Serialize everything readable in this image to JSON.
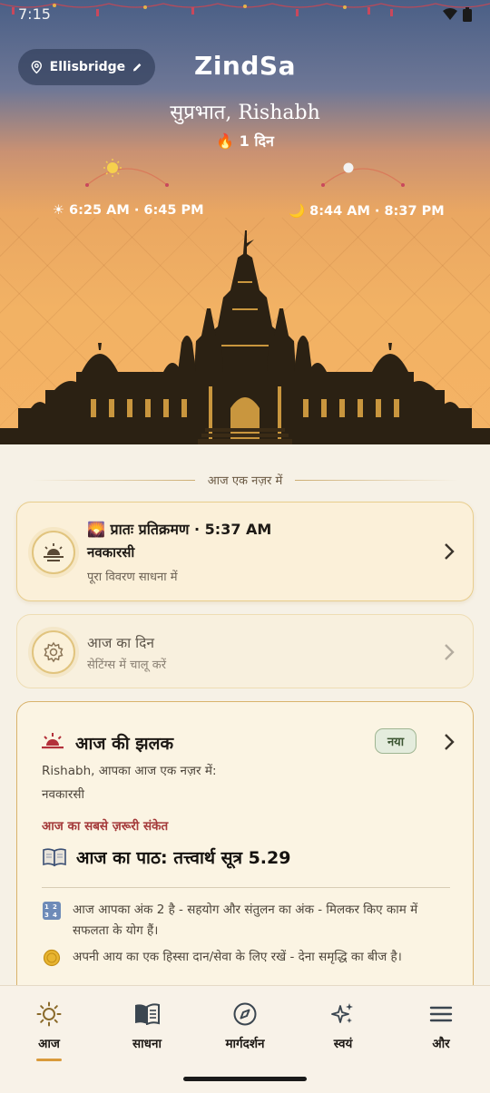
{
  "status": {
    "time": "7:15"
  },
  "header": {
    "location": "Ellisbridge",
    "app_title": "ZindSa",
    "greeting": "सुप्रभात, Rishabh",
    "streak": "🔥 1 दिन",
    "sun_times": "☀ 6:25 AM · 6:45 PM",
    "moon_times": "🌙 8:44 AM · 8:37 PM"
  },
  "section": {
    "title": "आज एक नज़र में"
  },
  "pratikraman_card": {
    "title": "🌄 प्रातः प्रतिक्रमण · 5:37 AM",
    "subtitle_bold": "नवकारसी",
    "subtitle": "पूरा विवरण साधना में"
  },
  "day_card": {
    "title": "आज का दिन",
    "subtitle": "सेटिंग्स में चालू करें"
  },
  "glimpse_card": {
    "title": "आज की झलक",
    "badge": "नया",
    "line1": "Rishabh, आपका आज एक नज़र में:",
    "line2": "नवकारसी",
    "signal": "आज का सबसे ज़रूरी संकेत",
    "path": "आज का पाठ: तत्त्वार्थ सूत्र 5.29",
    "tip1": "आज आपका अंक 2 है - सहयोग और संतुलन का अंक - मिलकर किए काम में सफलता के योग हैं।",
    "tip2": "अपनी आय का एक हिस्सा दान/सेवा के लिए रखें - देना समृद्धि का बीज है।"
  },
  "nav": {
    "items": [
      {
        "label": "आज",
        "icon": "sun-icon",
        "active": true
      },
      {
        "label": "साधना",
        "icon": "book-icon",
        "active": false
      },
      {
        "label": "मार्गदर्शन",
        "icon": "compass-icon",
        "active": false
      },
      {
        "label": "स्वयं",
        "icon": "sparkles-icon",
        "active": false
      },
      {
        "label": "और",
        "icon": "menu-icon",
        "active": false
      }
    ]
  },
  "colors": {
    "accent": "#D99A3A",
    "signal_red": "#A43A3A",
    "card_border": "#D9B36C"
  }
}
